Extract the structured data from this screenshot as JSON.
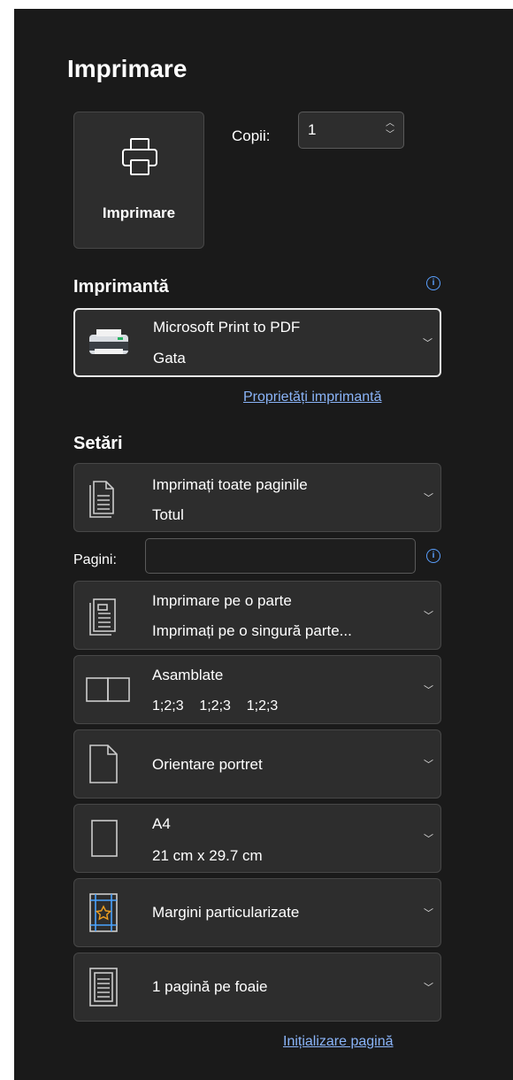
{
  "print": {
    "title": "Imprimare",
    "button_label": "Imprimare",
    "copies_label": "Copii:",
    "copies_value": "1"
  },
  "printer": {
    "section_title": "Imprimantă",
    "name": "Microsoft Print to PDF",
    "status": "Gata",
    "properties_link": "Proprietăți imprimantă"
  },
  "settings": {
    "section_title": "Setări",
    "pages_label": "Pagini:",
    "pages_value": "",
    "items": [
      {
        "line1": "Imprimați toate paginile",
        "line2": "Totul",
        "icon": "pages-icon"
      },
      {
        "line1": "Imprimare pe o parte",
        "line2": "Imprimați pe o singură parte...",
        "icon": "one-sided-icon"
      },
      {
        "line1": "Asamblate",
        "line2": "1;2;3    1;2;3    1;2;3",
        "icon": "collated-icon"
      },
      {
        "line1": "Orientare portret",
        "line2": "",
        "icon": "portrait-orientation-icon"
      },
      {
        "line1": "A4",
        "line2": "21 cm x 29.7 cm",
        "icon": "paper-size-icon"
      },
      {
        "line1": "Margini particularizate",
        "line2": "",
        "icon": "margins-icon"
      },
      {
        "line1": "1 pagină pe foaie",
        "line2": "",
        "icon": "pages-per-sheet-icon"
      }
    ],
    "page_setup_link": "Inițializare pagină"
  },
  "colors": {
    "panel": "#1a1a1a",
    "control": "#2d2d2d",
    "link": "#8ab4f8",
    "info": "#5aa0ff"
  }
}
